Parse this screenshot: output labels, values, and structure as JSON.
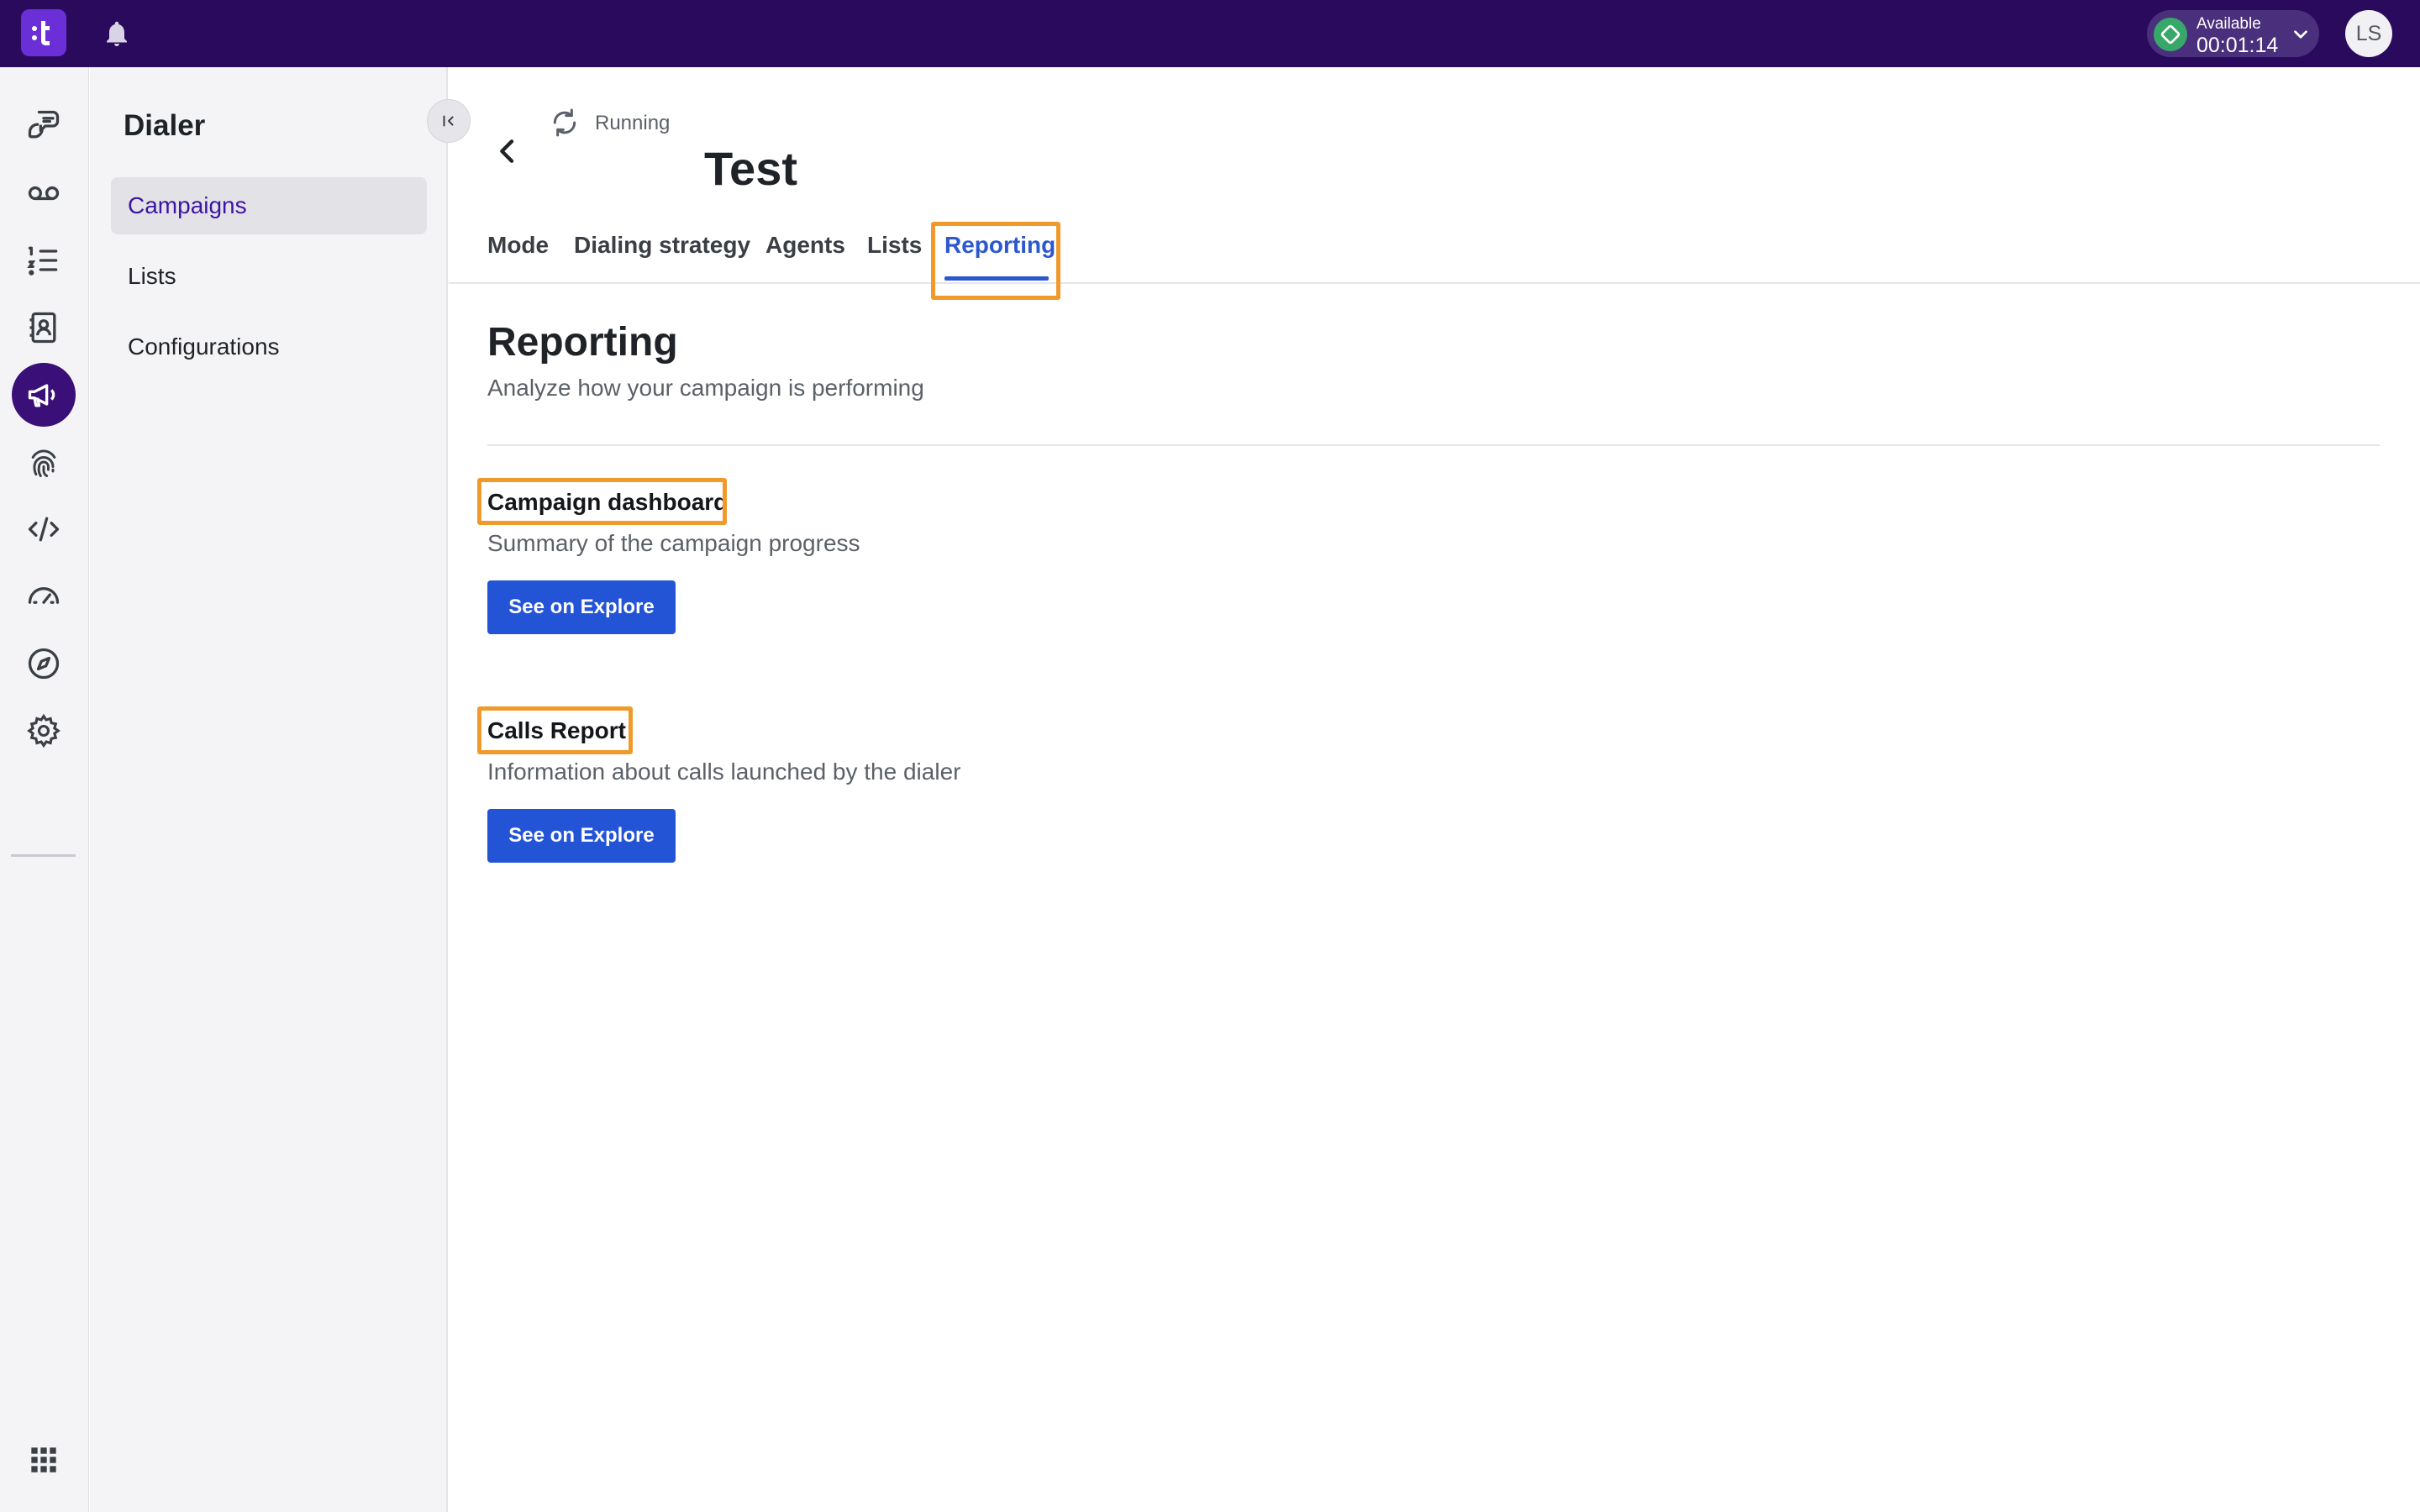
{
  "topbar": {
    "logo_text": "t",
    "status_label": "Available",
    "status_time": "00:01:14",
    "avatar_initials": "LS",
    "colors": {
      "background": "#2a0a5c",
      "available": "#37a76a"
    }
  },
  "rail": {
    "icons": [
      "conversations-icon",
      "voicemail-icon",
      "list-icon",
      "contacts-icon",
      "campaigns-icon",
      "fingerprint-icon",
      "code-icon",
      "dashboard-gauge-icon",
      "explore-compass-icon",
      "settings-gear-icon",
      "apps-grid-icon"
    ],
    "active": "campaigns-icon"
  },
  "sidebar": {
    "title": "Dialer",
    "items": [
      {
        "label": "Campaigns",
        "active": true
      },
      {
        "label": "Lists",
        "active": false
      },
      {
        "label": "Configurations",
        "active": false
      }
    ]
  },
  "header": {
    "status": "Running",
    "title": "Test"
  },
  "tabs": [
    {
      "label": "Mode",
      "active": false
    },
    {
      "label": "Dialing strategy",
      "active": false
    },
    {
      "label": "Agents",
      "active": false
    },
    {
      "label": "Lists",
      "active": false
    },
    {
      "label": "Reporting",
      "active": true
    }
  ],
  "reporting": {
    "title": "Reporting",
    "subtitle": "Analyze how your campaign is performing",
    "cards": [
      {
        "title": "Campaign dashboard",
        "subtitle": "Summary of the campaign progress",
        "button": "See on Explore"
      },
      {
        "title": "Calls Report",
        "subtitle": "Information about calls launched by the dialer",
        "button": "See on Explore"
      }
    ]
  },
  "accent_colors": {
    "primary": "#2454d6",
    "highlight": "#f09a2c",
    "active_nav": "#3d14a6"
  }
}
